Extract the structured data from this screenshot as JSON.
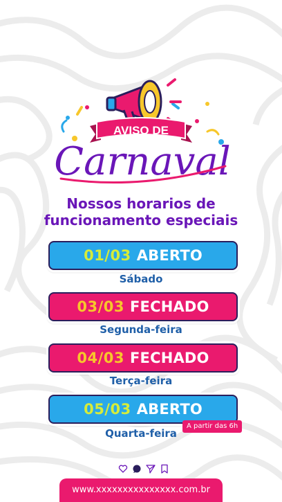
{
  "logo": {
    "badge_text": "AVISO DE",
    "title_text": "Carnaval"
  },
  "headline": {
    "line1": "Nossos horarios de",
    "line2": "funcionamento especiais"
  },
  "schedule": [
    {
      "date": "01/03",
      "status": "ABERTO",
      "day": "Sábado"
    },
    {
      "date": "03/03",
      "status": "FECHADO",
      "day": "Segunda-feira"
    },
    {
      "date": "04/03",
      "status": "FECHADO",
      "day": "Terça-feira"
    },
    {
      "date": "05/03",
      "status": "ABERTO",
      "day": "Quarta-feira"
    }
  ],
  "note": "A partir das 6h",
  "social_icons": [
    "heart-icon",
    "comment-icon",
    "send-icon",
    "bookmark-icon"
  ],
  "footer": {
    "website": "www.xxxxxxxxxxxxxxx.com.br"
  },
  "colors": {
    "purple": "#6a16b8",
    "blue": "#29a8ea",
    "pink": "#ea1a6e",
    "lime": "#d6ec3a",
    "yellow": "#f7c72b",
    "day_text": "#1f5fa8"
  }
}
